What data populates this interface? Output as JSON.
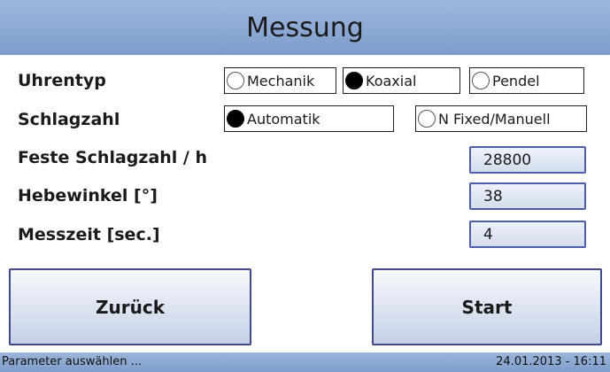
{
  "title": "Messung",
  "uhrentyp": {
    "label": "Uhrentyp",
    "options": [
      {
        "label": "Mechanik",
        "selected": false
      },
      {
        "label": "Koaxial",
        "selected": true
      },
      {
        "label": "Pendel",
        "selected": false
      }
    ]
  },
  "schlagzahl": {
    "label": "Schlagzahl",
    "options": [
      {
        "label": "Automatik",
        "selected": true
      },
      {
        "label": "N Fixed/Manuell",
        "selected": false
      }
    ]
  },
  "feste_schlagzahl": {
    "label": "Feste Schlagzahl / h",
    "value": "28800"
  },
  "hebewinkel": {
    "label": "Hebewinkel [°]",
    "value": "38"
  },
  "messzeit": {
    "label": "Messzeit [sec.]",
    "value": "4"
  },
  "buttons": {
    "back": "Zurück",
    "start": "Start"
  },
  "status": {
    "left": "Parameter auswählen ...",
    "right": "24.01.2013 - 16:11"
  }
}
